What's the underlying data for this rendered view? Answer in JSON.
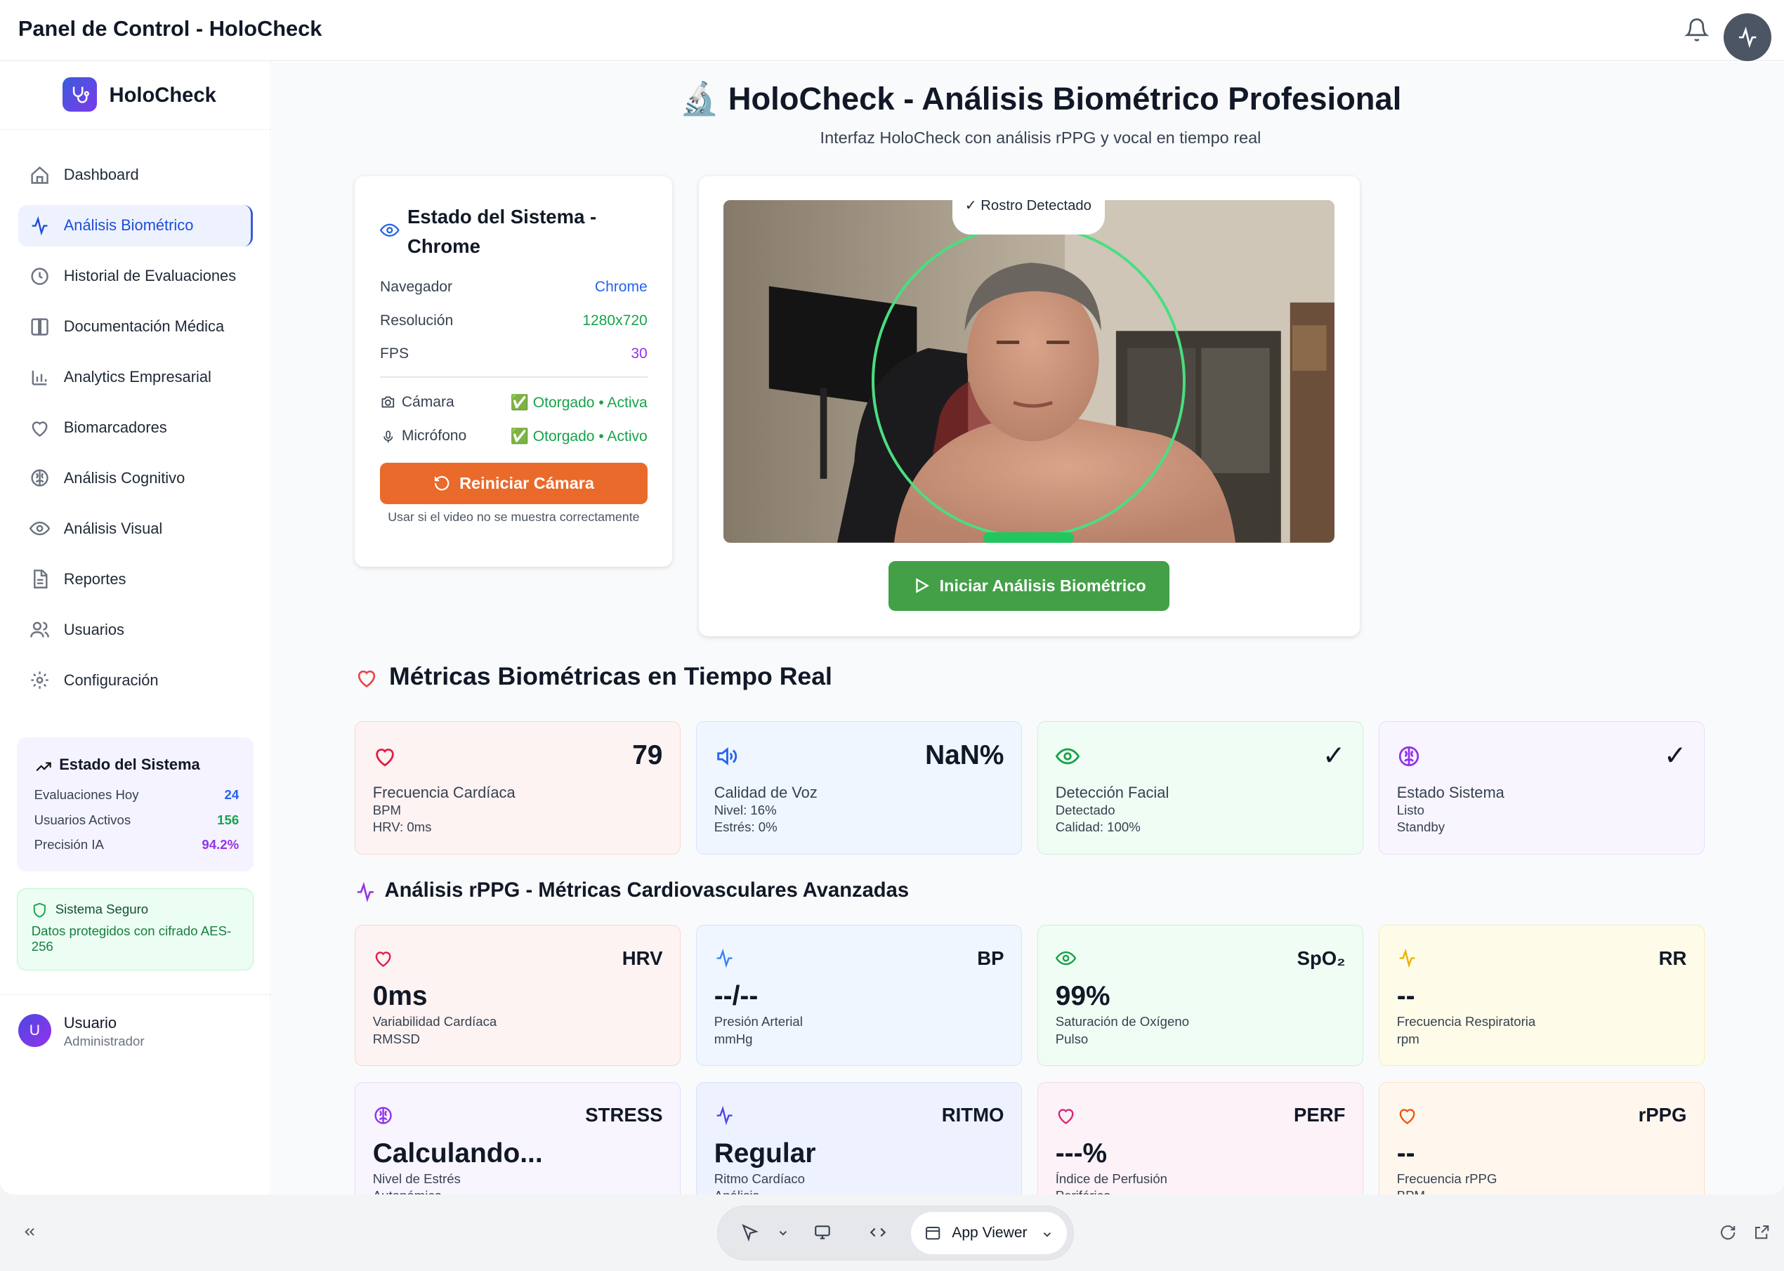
{
  "header": {
    "title": "Panel de Control - HoloCheck"
  },
  "sidebar": {
    "brand": "HoloCheck",
    "items": [
      {
        "label": "Dashboard",
        "icon": "home-icon"
      },
      {
        "label": "Análisis Biométrico",
        "icon": "activity-icon"
      },
      {
        "label": "Historial de Evaluaciones",
        "icon": "clock-icon"
      },
      {
        "label": "Documentación Médica",
        "icon": "book-icon"
      },
      {
        "label": "Analytics Empresarial",
        "icon": "bar-chart-icon"
      },
      {
        "label": "Biomarcadores",
        "icon": "heart-icon"
      },
      {
        "label": "Análisis Cognitivo",
        "icon": "brain-icon"
      },
      {
        "label": "Análisis Visual",
        "icon": "eye-icon"
      },
      {
        "label": "Reportes",
        "icon": "file-icon"
      },
      {
        "label": "Usuarios",
        "icon": "users-icon"
      },
      {
        "label": "Configuración",
        "icon": "gear-icon"
      }
    ],
    "active_index": 1,
    "status": {
      "title": "Estado del Sistema",
      "rows": [
        {
          "label": "Evaluaciones Hoy",
          "value": "24",
          "color": "#2563eb"
        },
        {
          "label": "Usuarios Activos",
          "value": "156",
          "color": "#16a34a"
        },
        {
          "label": "Precisión IA",
          "value": "94.2%",
          "color": "#9333ea"
        }
      ]
    },
    "security": {
      "title": "Sistema Seguro",
      "text": "Datos protegidos con cifrado AES-256"
    },
    "user": {
      "initial": "U",
      "name": "Usuario",
      "role": "Administrador"
    }
  },
  "main": {
    "title": "🔬 HoloCheck - Análisis Biométrico Profesional",
    "subtitle": "Interfaz HoloCheck con análisis rPPG y vocal en tiempo real",
    "system_card": {
      "title": "Estado del Sistema - Chrome",
      "browser_label": "Navegador",
      "browser_value": "Chrome",
      "resolution_label": "Resolución",
      "resolution_value": "1280x720",
      "fps_label": "FPS",
      "fps_value": "30",
      "camera_label": "Cámara",
      "camera_value": "✅ Otorgado • Activa",
      "mic_label": "Micrófono",
      "mic_value": "✅ Otorgado • Activo",
      "restart_button": "Reiniciar Cámara",
      "hint": "Usar si el video no se muestra correctamente"
    },
    "video": {
      "face_tag": "✓ Rostro Detectado",
      "start_button": "Iniciar Análisis Biométrico"
    },
    "metrics_title": "Métricas Biométricas en Tiempo Real",
    "metrics": [
      {
        "label": "Frecuencia Cardíaca",
        "value": "79",
        "sub1": "BPM",
        "sub2": "HRV: 0ms",
        "bg": "#fdf3f2",
        "border": "#f8d7d4",
        "icon": "heart-icon",
        "icon_color": "#e11d48"
      },
      {
        "label": "Calidad de Voz",
        "value": "NaN%",
        "sub1": "Nivel: 16%",
        "sub2": "Estrés: 0%",
        "bg": "#eff6ff",
        "border": "#d6e4fb",
        "icon": "volume-icon",
        "icon_color": "#2563eb"
      },
      {
        "label": "Detección Facial",
        "value": "✓",
        "sub1": "Detectado",
        "sub2": "Calidad: 100%",
        "bg": "#f0fdf4",
        "border": "#cdeed9",
        "icon": "eye-icon",
        "icon_color": "#16a34a"
      },
      {
        "label": "Estado Sistema",
        "value": "✓",
        "sub1": "Listo",
        "sub2": "Standby",
        "bg": "#f8f5ff",
        "border": "#e6ddfa",
        "icon": "brain-icon",
        "icon_color": "#9333ea"
      }
    ],
    "rppg_title": "Análisis rPPG - Métricas Cardiovasculares Avanzadas",
    "rppg": [
      {
        "code": "HRV",
        "value": "0ms",
        "l1": "Variabilidad Cardíaca",
        "l2": "RMSSD",
        "bg": "#fdf3f2",
        "border": "#f8d7d4",
        "icon": "heart-icon",
        "icon_color": "#e11d48"
      },
      {
        "code": "BP",
        "value": "--/--",
        "l1": "Presión Arterial",
        "l2": "mmHg",
        "bg": "#eff6ff",
        "border": "#d6e4fb",
        "icon": "activity-icon",
        "icon_color": "#3b82f6"
      },
      {
        "code": "SpO₂",
        "value": "99%",
        "l1": "Saturación de Oxígeno",
        "l2": "Pulso",
        "bg": "#f0fdf4",
        "border": "#cdeed9",
        "icon": "eye-icon",
        "icon_color": "#16a34a"
      },
      {
        "code": "RR",
        "value": "--",
        "l1": "Frecuencia Respiratoria",
        "l2": "rpm",
        "bg": "#fefce8",
        "border": "#f6ecb5",
        "icon": "activity-icon",
        "icon_color": "#eab308"
      },
      {
        "code": "STRESS",
        "value": "Calculando...",
        "l1": "Nivel de Estrés",
        "l2": "Autonómico",
        "bg": "#f8f5ff",
        "border": "#e6ddfa",
        "icon": "brain-icon",
        "icon_color": "#9333ea"
      },
      {
        "code": "RITMO",
        "value": "Regular",
        "l1": "Ritmo Cardíaco",
        "l2": "Análisis",
        "bg": "#eef2ff",
        "border": "#dadff8",
        "icon": "activity-icon",
        "icon_color": "#4f46e5"
      },
      {
        "code": "PERF",
        "value": "---%",
        "l1": "Índice de Perfusión",
        "l2": "Periférico",
        "bg": "#fdf2f8",
        "border": "#f6d6e8",
        "icon": "heart-icon",
        "icon_color": "#db2777"
      },
      {
        "code": "rPPG",
        "value": "--",
        "l1": "Frecuencia rPPG",
        "l2": "BPM",
        "bg": "#fff7ed",
        "border": "#fbe0c6",
        "icon": "heart-icon",
        "icon_color": "#ea580c"
      }
    ]
  },
  "bottombar": {
    "app_viewer": "App Viewer"
  }
}
